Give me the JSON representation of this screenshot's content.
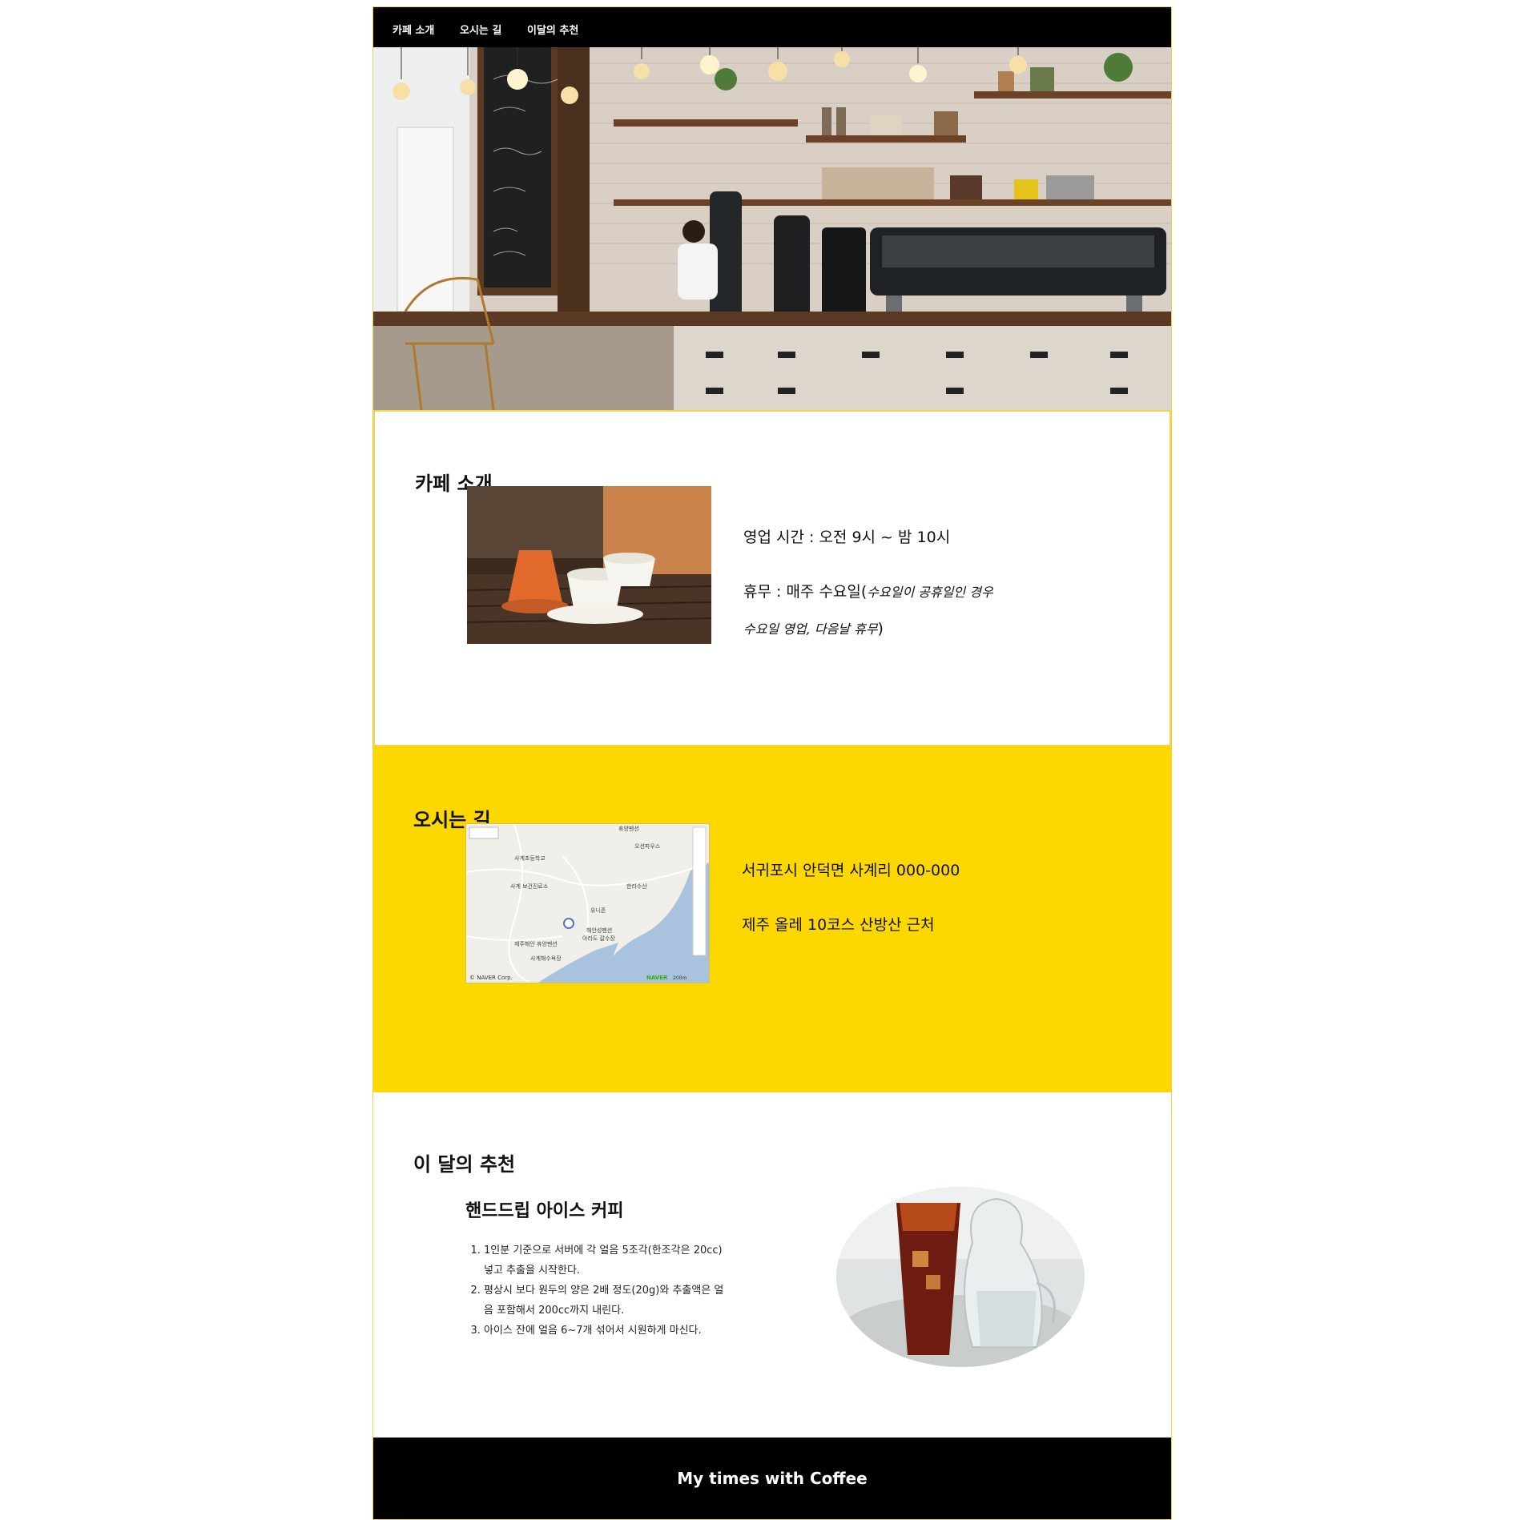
{
  "nav": {
    "items": [
      "카페 소개",
      "오시는 길",
      "이달의 추천"
    ]
  },
  "intro": {
    "title": "카페 소개",
    "hours": "영업 시간 : 오전 9시 ~ 밤 10시",
    "holiday_main": "휴무 : 매주 수요일(",
    "holiday_italic_1": "수요일이 공휴일인 경우",
    "holiday_italic_2": "수요일 영업, 다음날 휴무",
    "holiday_close": ")"
  },
  "route": {
    "title": "오시는 길",
    "address": "서귀포시 안덕면 사계리 000-000",
    "landmark": "제주 올레 10코스 산방산 근처",
    "map_labels": {
      "school": "사계초등학교",
      "clinic": "사계\n보건진료소",
      "village": "유니존",
      "pension": "해안성펜션",
      "aquarium": "아라도 갈수장",
      "harbor": "사계해수욕장",
      "rest": "제주해안\n휴양펜션",
      "hanra": "한라수산",
      "oseon": "오션파우스",
      "hyuyang": "휴양펜션",
      "credit": "© NAVER Corp.",
      "brand": "NAVER",
      "scale": "200m"
    }
  },
  "reco": {
    "title": "이 달의 추천",
    "subtitle": "핸드드립 아이스 커피",
    "steps": [
      "1인분 기준으로 서버에 각 얼음 5조각(한조각은 20cc) 넣고 추출을 시작한다.",
      "평상시 보다 원두의 양은 2배 정도(20g)와 추출액은 얼음 포함해서 200cc까지 내린다.",
      "아이스 잔에 얼음 6~7개 섞어서 시원하게 마신다."
    ]
  },
  "footer": {
    "text": "My times with Coffee"
  },
  "colors": {
    "accent_yellow": "#fdd700",
    "border_yellow": "#f2d44c",
    "nav_black": "#000000"
  }
}
